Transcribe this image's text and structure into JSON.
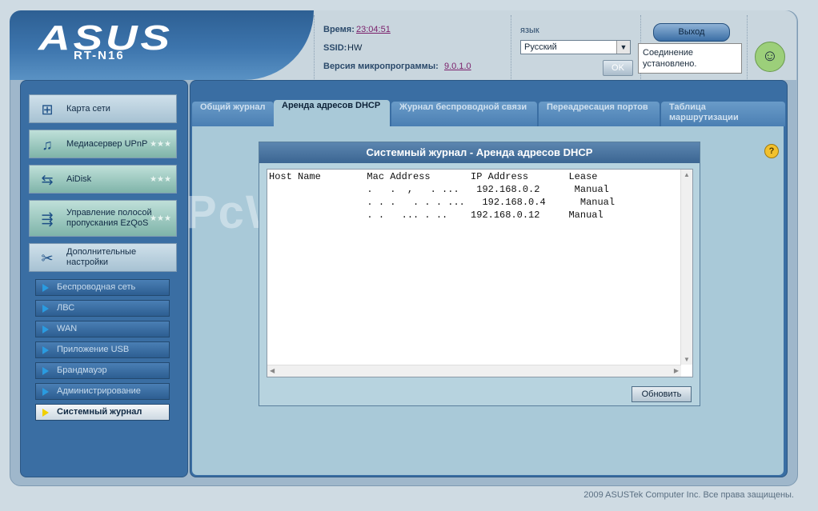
{
  "brand": {
    "logo": "ASUS",
    "model": "RT-N16"
  },
  "info": {
    "time_label": "Время:",
    "time_value": "23:04:51",
    "ssid_label": "SSID:",
    "ssid_value": "HW",
    "firmware_label": "Версия микропрограммы:",
    "firmware_value": "9.0.1.0"
  },
  "language": {
    "label": "язык",
    "selected": "Русский",
    "ok_label": "OK"
  },
  "session": {
    "logout_label": "Выход",
    "status_text": "Соединение установлено."
  },
  "sidebar": {
    "main_items": [
      {
        "label": "Карта сети",
        "icon": "network-map-icon"
      },
      {
        "label": "Медиасервер UPnP",
        "icon": "media-server-icon"
      },
      {
        "label": "AiDisk",
        "icon": "aidisk-icon"
      },
      {
        "label": "Управление полосой пропускания EzQoS",
        "icon": "qos-icon"
      },
      {
        "label": "Дополнительные настройки",
        "icon": "tools-icon"
      }
    ],
    "sub_items": [
      {
        "label": "Беспроводная сеть"
      },
      {
        "label": "ЛВС"
      },
      {
        "label": "WAN"
      },
      {
        "label": "Приложение USB"
      },
      {
        "label": "Брандмауэр"
      },
      {
        "label": "Администрирование"
      },
      {
        "label": "Системный журнал"
      }
    ]
  },
  "tabs": [
    {
      "label": "Общий журнал"
    },
    {
      "label": "Аренда адресов DHCP"
    },
    {
      "label": "Журнал беспроводной связи"
    },
    {
      "label": "Переадресация портов"
    },
    {
      "label": "Таблица маршрутизации"
    }
  ],
  "panel": {
    "title": "Системный журнал - Аренда адресов DHCP",
    "log_text": "Host Name        Mac Address       IP Address       Lease\n                 .   .  ,   . ...   192.168.0.2      Manual\n                 . . .   . . . ...   192.168.0.4      Manual\n                 . .   ... . ..    192.168.0.12     Manual",
    "refresh_label": "Обновить"
  },
  "footer": {
    "copyright": "2009 ASUSTek Computer Inc. Все права защищены."
  },
  "watermark": "PcWinTech.com",
  "colors": {
    "accent": "#3a6ea3",
    "panel_bg": "#a9c9d8",
    "link": "#7a1f6a"
  }
}
